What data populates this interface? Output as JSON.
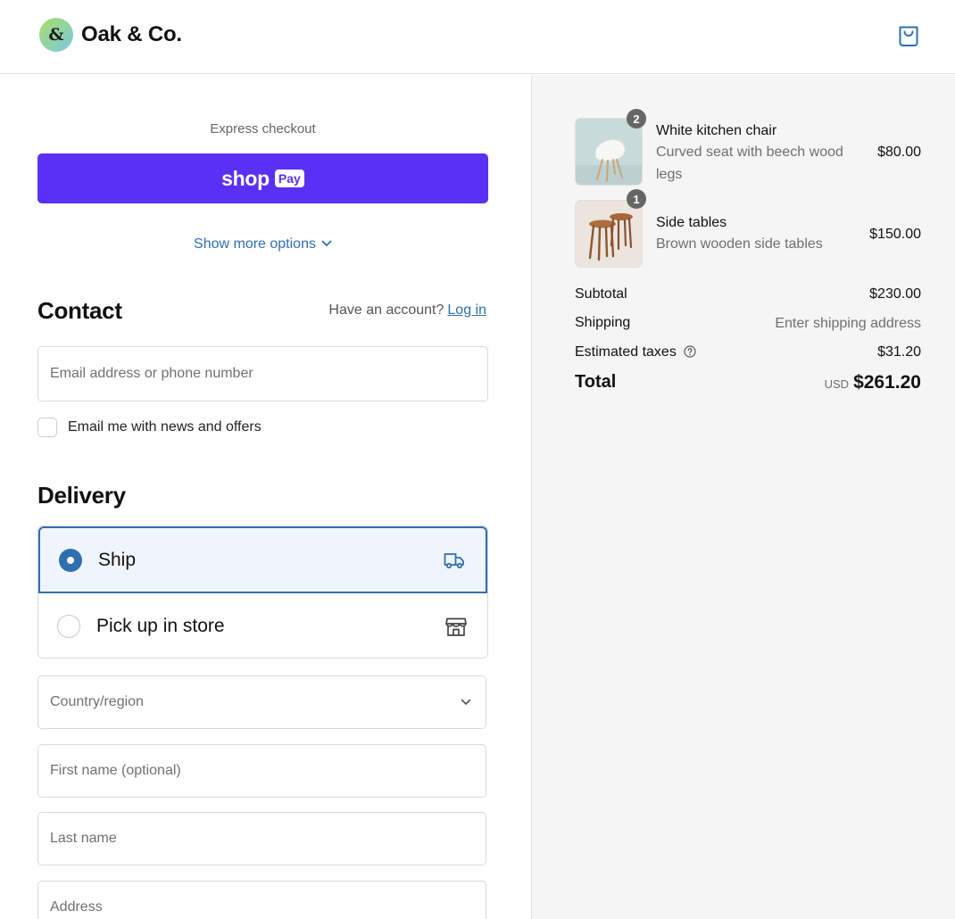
{
  "header": {
    "logo_mark": "&",
    "store_name": "Oak & Co.",
    "cart_icon": "shopping-bag-icon"
  },
  "express": {
    "label": "Express checkout",
    "shop_pay": {
      "word": "shop",
      "tag": "Pay"
    },
    "more_options": "Show more options"
  },
  "contact": {
    "title": "Contact",
    "account_prompt": "Have an account?",
    "login_link": "Log in",
    "email_placeholder": "Email address or phone number",
    "newsletter_label": "Email me with news and offers",
    "newsletter_checked": false
  },
  "delivery": {
    "title": "Delivery",
    "options": [
      {
        "label": "Ship",
        "selected": true,
        "icon": "truck-icon"
      },
      {
        "label": "Pick up in store",
        "selected": false,
        "icon": "store-icon"
      }
    ],
    "country_placeholder": "Country/region",
    "first_name_placeholder": "First name (optional)",
    "last_name_placeholder": "Last name",
    "address_placeholder": "Address"
  },
  "summary": {
    "items": [
      {
        "name": "White kitchen chair",
        "description": "Curved seat with beech wood legs",
        "price": "$80.00",
        "quantity": "2",
        "image_icon": "chair-thumbnail"
      },
      {
        "name": "Side tables",
        "description": "Brown wooden side tables",
        "price": "$150.00",
        "quantity": "1",
        "image_icon": "side-tables-thumbnail"
      }
    ],
    "subtotal_label": "Subtotal",
    "subtotal_value": "$230.00",
    "shipping_label": "Shipping",
    "shipping_value": "Enter shipping address",
    "taxes_label": "Estimated taxes",
    "taxes_value": "$31.20",
    "total_label": "Total",
    "currency": "USD",
    "total_value": "$261.20"
  },
  "colors": {
    "accent": "#2f6fb1",
    "shop_pay": "#5a31f4",
    "summary_bg": "#f5f5f5",
    "selected_bg": "#f0f5fd"
  }
}
